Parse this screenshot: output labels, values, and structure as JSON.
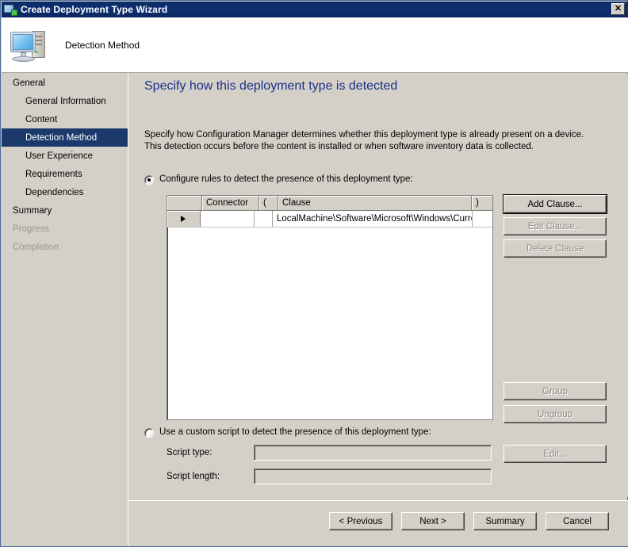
{
  "window": {
    "title": "Create Deployment Type Wizard",
    "close_label": "✕",
    "icon": "wizard-computer-icon"
  },
  "header": {
    "title": "Detection Method",
    "icon": "computer-monitor-icon"
  },
  "nav": {
    "items": [
      {
        "label": "General",
        "level": "top",
        "state": "normal"
      },
      {
        "label": "General Information",
        "level": "child",
        "state": "normal"
      },
      {
        "label": "Content",
        "level": "child",
        "state": "normal"
      },
      {
        "label": "Detection Method",
        "level": "child",
        "state": "selected"
      },
      {
        "label": "User Experience",
        "level": "child",
        "state": "normal"
      },
      {
        "label": "Requirements",
        "level": "child",
        "state": "normal"
      },
      {
        "label": "Dependencies",
        "level": "child",
        "state": "normal"
      },
      {
        "label": "Summary",
        "level": "top",
        "state": "normal"
      },
      {
        "label": "Progress",
        "level": "top",
        "state": "disabled"
      },
      {
        "label": "Completion",
        "level": "top",
        "state": "disabled"
      }
    ]
  },
  "main": {
    "heading": "Specify how this deployment type is detected",
    "description": "Specify how Configuration Manager determines whether this deployment type is already present on a device. This detection occurs before the content is installed or when software inventory data is collected.",
    "rules_option": {
      "label": "Configure rules to detect the presence of this deployment type:",
      "selected": true
    },
    "script_option": {
      "label": "Use a custom script to detect the presence of this deployment type:",
      "selected": false
    },
    "grid": {
      "columns": [
        "",
        "Connector",
        "(",
        "Clause",
        ")"
      ],
      "rows": [
        {
          "selector": "▶",
          "connector": "",
          "open_paren": "",
          "clause": "LocalMachine\\Software\\Microsoft\\Windows\\Curre...",
          "close_paren": ""
        }
      ]
    },
    "clause_buttons": [
      {
        "label": "Add Clause...",
        "enabled": true,
        "default": true
      },
      {
        "label": "Edit Clause...",
        "enabled": false,
        "default": false
      },
      {
        "label": "Delete Clause",
        "enabled": false,
        "default": false
      }
    ],
    "group_buttons": [
      {
        "label": "Group",
        "enabled": false
      },
      {
        "label": "Ungroup",
        "enabled": false
      }
    ],
    "script_fields": [
      {
        "label": "Script type:",
        "value": "",
        "enabled": false
      },
      {
        "label": "Script length:",
        "value": "",
        "enabled": false
      }
    ],
    "edit_button": {
      "label": "Edit...",
      "enabled": false
    }
  },
  "footer": {
    "buttons": [
      {
        "label": "< Previous",
        "enabled": true
      },
      {
        "label": "Next >",
        "enabled": true
      },
      {
        "label": "Summary",
        "enabled": true
      },
      {
        "label": "Cancel",
        "enabled": true
      }
    ]
  },
  "colors": {
    "titlebar": "#0b2a66",
    "nav_selected": "#1b3a6b",
    "heading": "#1b2f8a",
    "dialog_face": "#d4d0c8"
  }
}
